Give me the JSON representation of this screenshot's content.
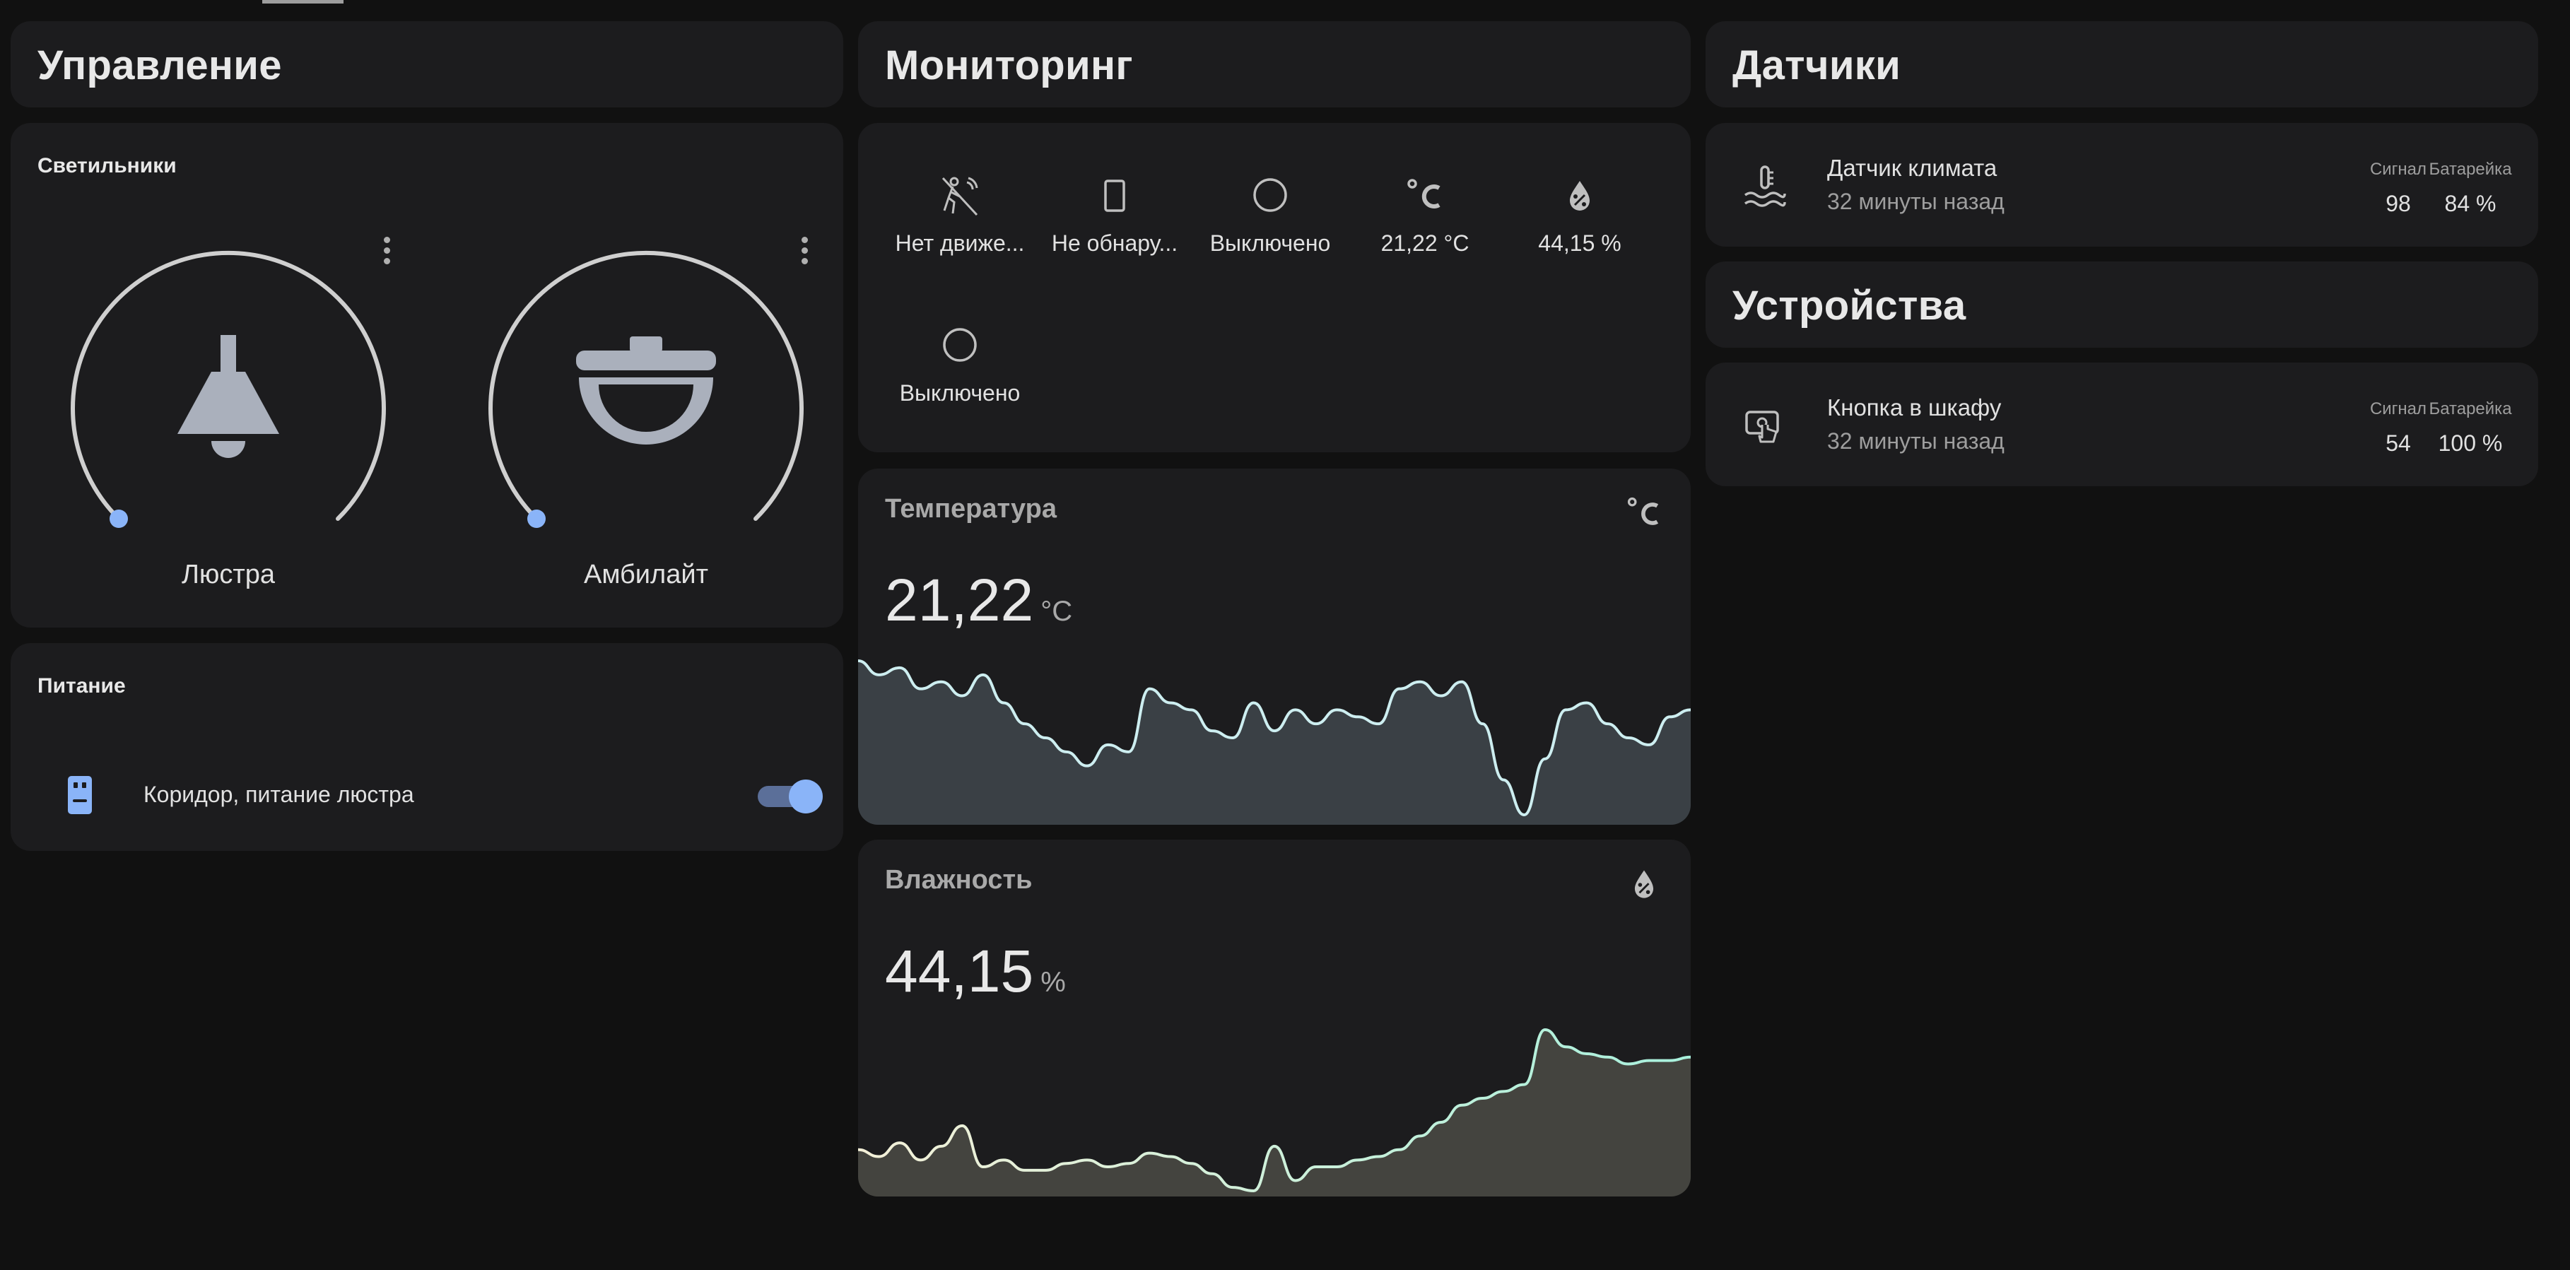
{
  "colors": {
    "accent": "#8ab4f8",
    "background": "#111111",
    "card": "#1c1c1e",
    "temp_line": "#cdeef0",
    "humidity_line_start": "#f4f0d8",
    "humidity_line_end": "#a8f0dc"
  },
  "columns": {
    "control": "Управление",
    "monitoring": "Мониторинг",
    "sensors": "Датчики",
    "devices": "Устройства"
  },
  "lights": {
    "title": "Светильники",
    "items": [
      {
        "name": "Люстра",
        "icon": "ceiling-lamp-icon",
        "brightness_percent": 0
      },
      {
        "name": "Амбилайт",
        "icon": "ceiling-light-icon",
        "brightness_percent": 0
      }
    ]
  },
  "power": {
    "title": "Питание",
    "items": [
      {
        "name": "Коридор, питание люстра",
        "icon": "power-socket-icon",
        "state": "on"
      }
    ]
  },
  "monitoring": {
    "items": [
      {
        "label": "Нет движе...",
        "icon": "motion-sensor-off-icon"
      },
      {
        "label": "Не обнару...",
        "icon": "door-sensor-icon"
      },
      {
        "label": "Выключено",
        "icon": "circle-outline-icon"
      },
      {
        "label": "21,22 °C",
        "icon": "celsius-icon"
      },
      {
        "label": "44,15 %",
        "icon": "water-percent-icon"
      },
      {
        "label": "Выключено",
        "icon": "circle-outline-icon"
      }
    ]
  },
  "temperature": {
    "title": "Температура",
    "value": "21,22",
    "unit": "°C",
    "icon": "celsius-icon",
    "chart_data": {
      "type": "area",
      "series": [
        {
          "values": [
            22.3,
            22.1,
            22.2,
            21.9,
            22.0,
            21.8,
            22.1,
            21.7,
            21.4,
            21.2,
            21.0,
            20.8,
            21.1,
            21.0,
            21.9,
            21.7,
            21.6,
            21.3,
            21.2,
            21.7,
            21.3,
            21.6,
            21.4,
            21.6,
            21.5,
            21.4,
            21.9,
            22.0,
            21.8,
            22.0,
            21.4,
            20.6,
            20.1,
            20.9,
            21.6,
            21.7,
            21.4,
            21.2,
            21.1,
            21.5,
            21.6
          ]
        }
      ]
    }
  },
  "humidity": {
    "title": "Влажность",
    "value": "44,15",
    "unit": "%",
    "icon": "water-percent-icon",
    "chart_data": {
      "type": "area",
      "series": [
        {
          "values": [
            38.5,
            38.3,
            38.7,
            38.2,
            38.6,
            39.2,
            38.0,
            38.2,
            37.9,
            37.9,
            38.1,
            38.2,
            38.0,
            38.1,
            38.4,
            38.3,
            38.1,
            37.8,
            37.4,
            37.3,
            38.6,
            37.6,
            38.0,
            38.0,
            38.2,
            38.3,
            38.5,
            38.9,
            39.3,
            39.8,
            40.0,
            40.2,
            40.4,
            42.0,
            41.5,
            41.3,
            41.2,
            41.0,
            41.1,
            41.1,
            41.2
          ]
        }
      ]
    }
  },
  "sensors": {
    "items": [
      {
        "name": "Датчик климата",
        "sub": "32 минуты назад",
        "icon": "thermometer-water-icon",
        "signal_label": "Сигнал",
        "signal": "98",
        "battery_label": "Батарейка",
        "battery": "84 %"
      }
    ]
  },
  "devices": {
    "items": [
      {
        "name": "Кнопка в шкафу",
        "sub": "32 минуты назад",
        "icon": "gesture-tap-button-icon",
        "signal_label": "Сигнал",
        "signal": "54",
        "battery_label": "Батарейка",
        "battery": "100 %"
      }
    ]
  }
}
